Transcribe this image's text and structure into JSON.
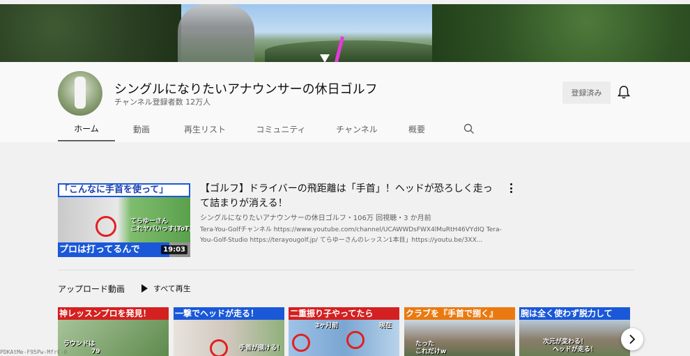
{
  "channel": {
    "name": "シングルになりたいアナウンサーの休日ゴルフ",
    "subscribers": "チャンネル登録者数 12万人",
    "subscribe_label": "登録済み"
  },
  "tabs": [
    {
      "label": "ホーム",
      "active": true
    },
    {
      "label": "動画"
    },
    {
      "label": "再生リスト"
    },
    {
      "label": "コミュニティ"
    },
    {
      "label": "チャンネル"
    },
    {
      "label": "概要"
    }
  ],
  "featured": {
    "thumb_top": "「こんなに手首を使って」",
    "thumb_bottom": "プロは打ってるんで",
    "thumb_caption_1": "てらゆーさん",
    "thumb_caption_2": "これヤバいっす(ToT)",
    "duration": "19:03",
    "title": "【ゴルフ】ドライバーの飛距離は「手首」！ヘッドが恐ろしく走って詰まりが消える！",
    "meta": "シングルになりたいアナウンサーの休日ゴルフ・106万 回視聴・3 か月前",
    "description": "Tera-You-Golfチャンネル https://www.youtube.com/channel/UCAWWDsFWX4lMuRtH46VYdIQ Tera-You-Golf-Studio https://terayougolf.jp/ てらゆーさんのレッスン1本目」https://youtu.be/3XX..."
  },
  "uploads": {
    "title": "アップロード動画",
    "play_all": "すべて再生",
    "cards": [
      {
        "banner": "神レッスンプロを発見！",
        "banner_color": "#d42020",
        "caption": "ラウンドは",
        "caption2": "79"
      },
      {
        "banner": "一撃でヘッドが走る！",
        "banner_color": "#1a58d8",
        "caption": "手首が捌ける！"
      },
      {
        "banner": "二重振り子やってたら",
        "banner_color": "#d42020",
        "caption": "3ヶ月前",
        "caption2": "現在"
      },
      {
        "banner": "クラブを『手首で捌く』",
        "banner_color": "#ea7a10",
        "caption": "たった",
        "caption2": "これだけw"
      },
      {
        "banner": "腕は全く使わず脱力して",
        "banner_color": "#1a58d8",
        "caption": "次元が変わる！",
        "caption2": "ヘッドが走る！"
      }
    ]
  },
  "statusbar": {
    "url_peek": "PDKAtMe-F95Pw-MfrC-0"
  }
}
